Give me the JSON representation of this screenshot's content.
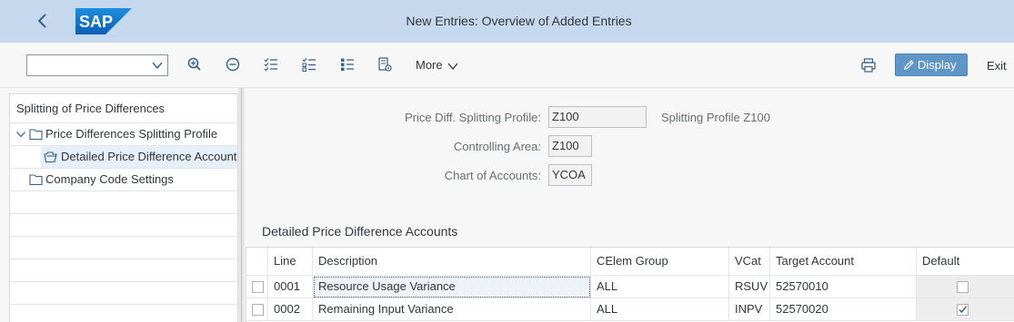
{
  "shell": {
    "title": "New Entries: Overview of Added Entries",
    "logo_text": "SAP"
  },
  "toolbar": {
    "dropdown_value": "",
    "more_label": "More",
    "display_label": "Display",
    "exit_label": "Exit",
    "icons": [
      "zoom-in-icon",
      "collapse-icon",
      "select-all-icon",
      "deselect-all-icon",
      "list-icon",
      "settings-icon",
      "chevron-down-icon",
      "print-icon",
      "pencil-icon"
    ]
  },
  "tree": {
    "header": "Splitting of Price Differences",
    "items": [
      {
        "label": "Price Differences Splitting Profile",
        "icon": "folder-open-icon",
        "expanded": true
      },
      {
        "label": "Detailed Price Difference Accounts",
        "icon": "folder-open-icon",
        "selected": true
      },
      {
        "label": "Company Code Settings",
        "icon": "folder-icon"
      }
    ]
  },
  "form": {
    "profile_label": "Price Diff. Splitting Profile:",
    "profile_value": "Z100",
    "profile_desc": "Splitting Profile Z100",
    "controlling_label": "Controlling Area:",
    "controlling_value": "Z100",
    "coa_label": "Chart of Accounts:",
    "coa_value": "YCOA"
  },
  "table": {
    "title": "Detailed Price Difference Accounts",
    "columns": [
      "Line",
      "Description",
      "CElem Group",
      "VCat",
      "Target Account",
      "Default"
    ],
    "rows": [
      {
        "line": "0001",
        "description": "Resource Usage Variance",
        "celem_group": "ALL",
        "vcat": "RSUV",
        "target_account": "52570010",
        "default": false
      },
      {
        "line": "0002",
        "description": "Remaining Input Variance",
        "celem_group": "ALL",
        "vcat": "INPV",
        "target_account": "52570020",
        "default": true
      }
    ]
  },
  "colors": {
    "shell_bg": "#c5d8ed",
    "accent": "#5f96c8",
    "logo_blue": "#1873cc"
  }
}
